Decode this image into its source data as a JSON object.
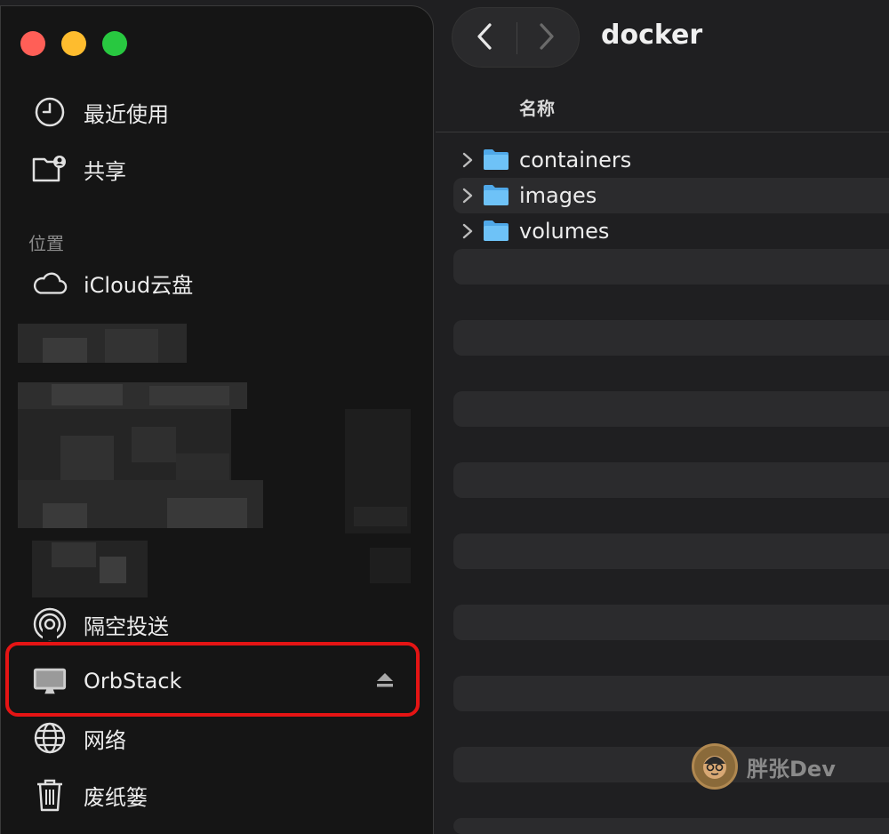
{
  "window": {
    "title": "docker"
  },
  "traffic_lights": {
    "close": "#ff5f57",
    "minimize": "#febc2e",
    "zoom": "#28c840"
  },
  "sidebar": {
    "favorites": [
      {
        "label": "最近使用",
        "icon": "clock-icon"
      },
      {
        "label": "共享",
        "icon": "shared-folder-icon"
      }
    ],
    "locations_label": "位置",
    "locations": [
      {
        "label": "iCloud云盘",
        "icon": "cloud-icon"
      },
      {
        "label": "隔空投送",
        "icon": "airdrop-icon"
      },
      {
        "label": "OrbStack",
        "icon": "display-icon",
        "eject": "eject-icon",
        "highlighted": true
      },
      {
        "label": "网络",
        "icon": "globe-icon"
      },
      {
        "label": "废纸篓",
        "icon": "trash-icon"
      }
    ]
  },
  "toolbar": {
    "back": "chevron-left-icon",
    "forward": "chevron-right-icon"
  },
  "list": {
    "column_name": "名称",
    "items": [
      {
        "name": "containers",
        "icon": "folder-icon"
      },
      {
        "name": "images",
        "icon": "folder-icon"
      },
      {
        "name": "volumes",
        "icon": "folder-icon"
      }
    ]
  },
  "watermark": {
    "text": "胖张Dev"
  },
  "colors": {
    "accent_highlight": "#e51414",
    "folder_blue": "#5ab6f0"
  }
}
